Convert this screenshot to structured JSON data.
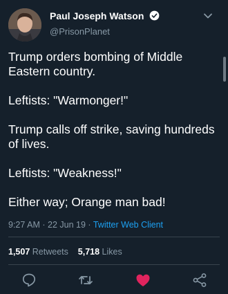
{
  "author": {
    "name": "Paul Joseph Watson",
    "handle": "@PrisonPlanet",
    "verified": true
  },
  "tweet": {
    "paragraphs": [
      "Trump orders bombing of Middle Eastern country.",
      "Leftists: \"Warmonger!\"",
      "Trump calls off strike, saving hundreds of lives.",
      "Leftists: \"Weakness!\"",
      "Either way; Orange man bad!"
    ],
    "time": "9:27 AM",
    "date": "22 Jun 19",
    "separator": "·",
    "client": "Twitter Web Client"
  },
  "stats": {
    "retweets_count": "1,507",
    "retweets_label": "Retweets",
    "likes_count": "5,718",
    "likes_label": "Likes"
  },
  "actions": {
    "icons": [
      "reply-icon",
      "retweet-icon",
      "like-icon",
      "share-icon"
    ],
    "like_color": "#e0245e"
  },
  "colors": {
    "background": "#15202b",
    "muted": "#8899a6",
    "link": "#1da1f2",
    "divider": "#38444d"
  }
}
